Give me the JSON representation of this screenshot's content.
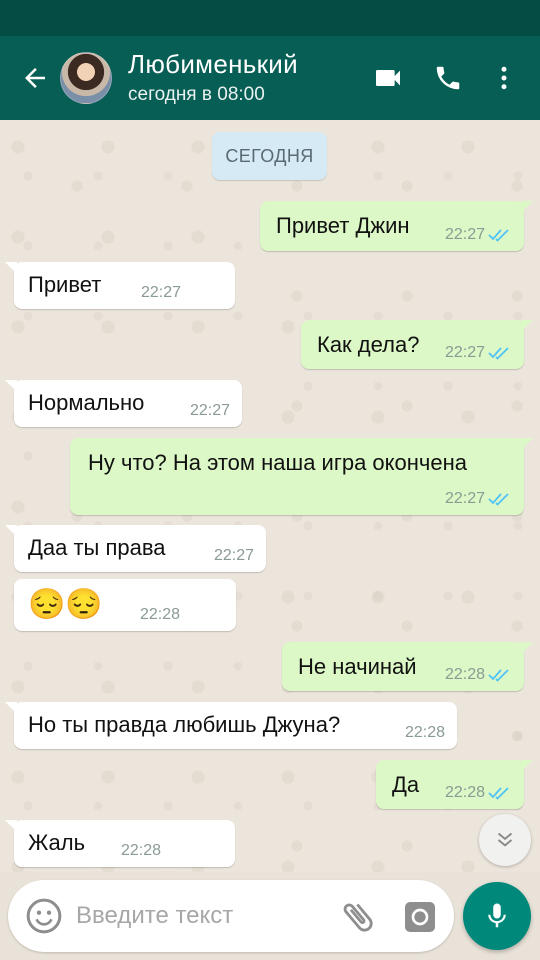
{
  "header": {
    "contact_name": "Любименький",
    "last_seen": "сегодня в 08:00"
  },
  "date_chip": "СЕГОДНЯ",
  "messages": [
    {
      "dir": "out",
      "text": "Привет Джин",
      "time": "22:27",
      "read": true
    },
    {
      "dir": "in",
      "text": "Привет",
      "time": "22:27"
    },
    {
      "dir": "out",
      "text": "Как дела?",
      "time": "22:27",
      "read": true
    },
    {
      "dir": "in",
      "text": "Нормально",
      "time": "22:27"
    },
    {
      "dir": "out",
      "text": "Ну что? На этом наша игра окончена",
      "time": "22:27",
      "read": true
    },
    {
      "dir": "in",
      "text": "Даа ты права",
      "time": "22:27"
    },
    {
      "dir": "in",
      "text": "😔😔",
      "time": "22:28"
    },
    {
      "dir": "out",
      "text": "Не начинай",
      "time": "22:28",
      "read": true
    },
    {
      "dir": "in",
      "text": "Но ты правда любишь Джуна?",
      "time": "22:28"
    },
    {
      "dir": "out",
      "text": "Да",
      "time": "22:28",
      "read": true
    },
    {
      "dir": "in",
      "text": "Жаль",
      "time": "22:28"
    }
  ],
  "composer": {
    "placeholder": "Введите текст"
  },
  "icons": [
    "back-arrow-icon",
    "video-call-icon",
    "phone-icon",
    "more-vert-icon",
    "emoji-icon",
    "attach-icon",
    "camera-icon",
    "mic-icon",
    "chevron-down-double-icon",
    "double-check-icon"
  ],
  "colors": {
    "app_bar": "#075e54",
    "status_bar": "#054c44",
    "outgoing_bubble": "#dcf8c6",
    "incoming_bubble": "#ffffff",
    "read_ticks": "#4fc3f7",
    "mic_button": "#00897b",
    "date_chip": "#d5eaf4"
  }
}
